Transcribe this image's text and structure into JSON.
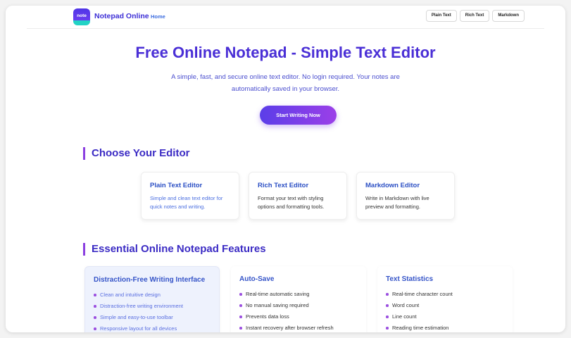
{
  "nav": {
    "logo_text": "note",
    "brand": "Notepad Online",
    "home": "Home",
    "buttons": [
      "Plain Text",
      "Rich Text",
      "Markdown"
    ]
  },
  "hero": {
    "title": "Free Online Notepad - Simple Text Editor",
    "subtitle": "A simple, fast, and secure online text editor. No login required. Your notes are automatically saved in your browser.",
    "cta": "Start Writing Now"
  },
  "editors": {
    "title": "Choose Your Editor",
    "cards": [
      {
        "title": "Plain Text Editor",
        "desc": "Simple and clean text editor for quick notes and writing."
      },
      {
        "title": "Rich Text Editor",
        "desc": "Format your text with styling options and formatting tools."
      },
      {
        "title": "Markdown Editor",
        "desc": "Write in Markdown with live preview and formatting."
      }
    ]
  },
  "features": {
    "title": "Essential Online Notepad Features",
    "cards": [
      {
        "title": "Distraction-Free Writing Interface",
        "items": [
          "Clean and intuitive design",
          "Distraction-free writing environment",
          "Simple and easy-to-use toolbar",
          "Responsive layout for all devices"
        ]
      },
      {
        "title": "Auto-Save",
        "items": [
          "Real-time automatic saving",
          "No manual saving required",
          "Prevents data loss",
          "Instant recovery after browser refresh"
        ]
      },
      {
        "title": "Text Statistics",
        "items": [
          "Real-time character count",
          "Word count",
          "Line count",
          "Reading time estimation"
        ]
      }
    ]
  },
  "colors": {
    "accent": "#4a2fd6",
    "cta_start": "#5b3ee8",
    "cta_end": "#9b3fe8",
    "section_bar": "#8b3fe0"
  }
}
